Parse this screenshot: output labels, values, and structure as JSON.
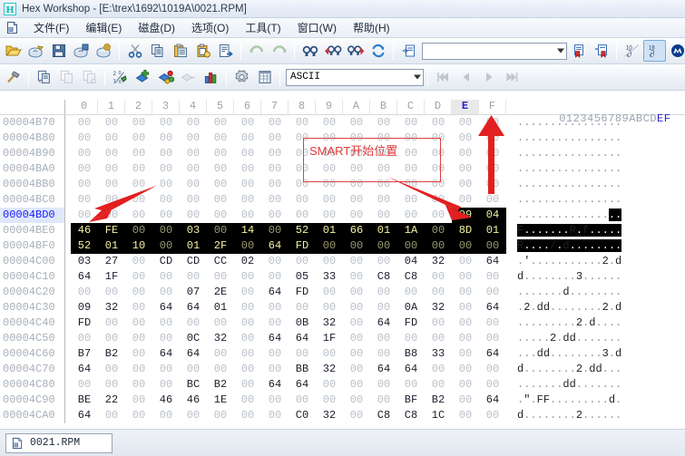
{
  "window": {
    "app_name": "Hex Workshop",
    "title": "Hex Workshop - [E:\\trex\\1692\\1019A\\0021.RPM]",
    "logo_glyph": "H"
  },
  "menu": {
    "doc_icon": "document-icon",
    "items": [
      {
        "label": "文件(F)",
        "name": "menu-file"
      },
      {
        "label": "编辑(E)",
        "name": "menu-edit"
      },
      {
        "label": "磁盘(D)",
        "name": "menu-disk"
      },
      {
        "label": "选项(O)",
        "name": "menu-options"
      },
      {
        "label": "工具(T)",
        "name": "menu-tools"
      },
      {
        "label": "窗口(W)",
        "name": "menu-window"
      },
      {
        "label": "帮助(H)",
        "name": "menu-help"
      }
    ]
  },
  "toolbar1": {
    "buttons": [
      {
        "name": "open-file-icon",
        "title": "Open"
      },
      {
        "name": "open-drive-icon",
        "title": "Open Drive"
      },
      {
        "name": "save-icon",
        "title": "Save"
      },
      {
        "name": "save-all-icon",
        "title": "Save All"
      },
      {
        "name": "save-settings-icon",
        "title": "Save Settings"
      },
      {
        "name": "cut-icon",
        "title": "Cut"
      },
      {
        "name": "copy-icon",
        "title": "Copy"
      },
      {
        "name": "paste-icon",
        "title": "Paste"
      },
      {
        "name": "paste-special-icon",
        "title": "Paste Special"
      },
      {
        "name": "export-icon",
        "title": "Export"
      },
      {
        "name": "undo-icon",
        "title": "Undo"
      },
      {
        "name": "redo-icon",
        "title": "Redo"
      },
      {
        "name": "find-icon",
        "title": "Find"
      },
      {
        "name": "find-prev-icon",
        "title": "Find Previous"
      },
      {
        "name": "find-next-icon",
        "title": "Find Next"
      },
      {
        "name": "refresh-icon",
        "title": "Refresh"
      },
      {
        "name": "goto-icon",
        "title": "Goto"
      }
    ],
    "address_combo_value": "",
    "after_combo": [
      {
        "name": "bookmark-add-icon",
        "title": "Add Bookmark"
      },
      {
        "name": "bookmark-clear-icon",
        "title": "Clear Bookmark"
      },
      {
        "name": "base10-icon",
        "title": "Base 10"
      },
      {
        "name": "base16-icon",
        "title": "Base 16"
      },
      {
        "name": "motorola-icon",
        "title": "Motorola Byte Order"
      },
      {
        "name": "intel-icon",
        "title": "Intel Byte Order"
      }
    ]
  },
  "toolbar2": {
    "buttons": [
      {
        "name": "hammer-icon",
        "title": "Operations"
      },
      {
        "name": "compare-icon",
        "title": "Compare"
      },
      {
        "name": "checksum-icon",
        "title": "Checksum"
      },
      {
        "name": "checksum2-icon",
        "title": "Checksum 2"
      },
      {
        "name": "base-convert-icon",
        "title": "Base Converter"
      },
      {
        "name": "add-structure-icon",
        "title": "Add Structure"
      },
      {
        "name": "add-colormap-icon",
        "title": "Add Color Map"
      },
      {
        "name": "goto-struct-icon",
        "title": "Goto Structure"
      },
      {
        "name": "statistics-icon",
        "title": "Statistics"
      },
      {
        "name": "settings-icon",
        "title": "Preferences"
      },
      {
        "name": "data-inspector-icon",
        "title": "Data Inspector"
      }
    ],
    "charset_combo_value": "ASCII",
    "nav": [
      {
        "name": "nav-first-icon",
        "glyph": "⏮"
      },
      {
        "name": "nav-prev-icon",
        "glyph": "◀"
      },
      {
        "name": "nav-next-icon",
        "glyph": "▶"
      },
      {
        "name": "nav-last-icon",
        "glyph": "⏭"
      }
    ]
  },
  "hex_view": {
    "column_headers": [
      "0",
      "1",
      "2",
      "3",
      "4",
      "5",
      "6",
      "7",
      "8",
      "9",
      "A",
      "B",
      "C",
      "D",
      "E",
      "F"
    ],
    "highlighted_column": "E",
    "ascii_header": "0123456789ABCD",
    "ascii_header_hl": "EF",
    "current_offset_row": "00004BD0",
    "selection": {
      "start": "00004BDE",
      "end": "00004BFF"
    },
    "rows": [
      {
        "offset": "00004B70",
        "bytes": [
          "00",
          "00",
          "00",
          "00",
          "00",
          "00",
          "00",
          "00",
          "00",
          "00",
          "00",
          "00",
          "00",
          "00",
          "00",
          "00"
        ],
        "ascii": "................"
      },
      {
        "offset": "00004B80",
        "bytes": [
          "00",
          "00",
          "00",
          "00",
          "00",
          "00",
          "00",
          "00",
          "00",
          "00",
          "00",
          "00",
          "00",
          "00",
          "00",
          "00"
        ],
        "ascii": "................"
      },
      {
        "offset": "00004B90",
        "bytes": [
          "00",
          "00",
          "00",
          "00",
          "00",
          "00",
          "00",
          "00",
          "00",
          "00",
          "00",
          "00",
          "00",
          "00",
          "00",
          "00"
        ],
        "ascii": "................"
      },
      {
        "offset": "00004BA0",
        "bytes": [
          "00",
          "00",
          "00",
          "00",
          "00",
          "00",
          "00",
          "00",
          "00",
          "00",
          "00",
          "00",
          "00",
          "00",
          "00",
          "00"
        ],
        "ascii": "................"
      },
      {
        "offset": "00004BB0",
        "bytes": [
          "00",
          "00",
          "00",
          "00",
          "00",
          "00",
          "00",
          "00",
          "00",
          "00",
          "00",
          "00",
          "00",
          "00",
          "00",
          "00"
        ],
        "ascii": "................"
      },
      {
        "offset": "00004BC0",
        "bytes": [
          "00",
          "00",
          "00",
          "00",
          "00",
          "00",
          "00",
          "00",
          "00",
          "00",
          "00",
          "00",
          "00",
          "00",
          "00",
          "00"
        ],
        "ascii": "................"
      },
      {
        "offset": "00004BD0",
        "bytes": [
          "00",
          "00",
          "00",
          "00",
          "00",
          "00",
          "00",
          "00",
          "00",
          "00",
          "00",
          "00",
          "00",
          "00",
          "09",
          "04"
        ],
        "ascii": "................"
      },
      {
        "offset": "00004BE0",
        "bytes": [
          "46",
          "FE",
          "00",
          "00",
          "03",
          "00",
          "14",
          "00",
          "52",
          "01",
          "66",
          "01",
          "1A",
          "00",
          "8D",
          "01"
        ],
        "ascii": "F.......R.f....."
      },
      {
        "offset": "00004BF0",
        "bytes": [
          "52",
          "01",
          "10",
          "00",
          "01",
          "2F",
          "00",
          "64",
          "FD",
          "00",
          "00",
          "00",
          "00",
          "00",
          "00",
          "00"
        ],
        "ascii": "R..../.d........"
      },
      {
        "offset": "00004C00",
        "bytes": [
          "03",
          "27",
          "00",
          "CD",
          "CD",
          "CC",
          "02",
          "00",
          "00",
          "00",
          "00",
          "00",
          "04",
          "32",
          "00",
          "64"
        ],
        "ascii": ".'...........2.d"
      },
      {
        "offset": "00004C10",
        "bytes": [
          "64",
          "1F",
          "00",
          "00",
          "00",
          "00",
          "00",
          "00",
          "05",
          "33",
          "00",
          "C8",
          "C8",
          "00",
          "00",
          "00"
        ],
        "ascii": "d........3......"
      },
      {
        "offset": "00004C20",
        "bytes": [
          "00",
          "00",
          "00",
          "00",
          "07",
          "2E",
          "00",
          "64",
          "FD",
          "00",
          "00",
          "00",
          "00",
          "00",
          "00",
          "00"
        ],
        "ascii": ".......d........"
      },
      {
        "offset": "00004C30",
        "bytes": [
          "09",
          "32",
          "00",
          "64",
          "64",
          "01",
          "00",
          "00",
          "00",
          "00",
          "00",
          "00",
          "0A",
          "32",
          "00",
          "64"
        ],
        "ascii": ".2.dd........2.d"
      },
      {
        "offset": "00004C40",
        "bytes": [
          "FD",
          "00",
          "00",
          "00",
          "00",
          "00",
          "00",
          "00",
          "0B",
          "32",
          "00",
          "64",
          "FD",
          "00",
          "00",
          "00"
        ],
        "ascii": ".........2.d...."
      },
      {
        "offset": "00004C50",
        "bytes": [
          "00",
          "00",
          "00",
          "00",
          "0C",
          "32",
          "00",
          "64",
          "64",
          "1F",
          "00",
          "00",
          "00",
          "00",
          "00",
          "00"
        ],
        "ascii": ".....2.dd......."
      },
      {
        "offset": "00004C60",
        "bytes": [
          "B7",
          "B2",
          "00",
          "64",
          "64",
          "00",
          "00",
          "00",
          "00",
          "00",
          "00",
          "00",
          "B8",
          "33",
          "00",
          "64"
        ],
        "ascii": "...dd........3.d"
      },
      {
        "offset": "00004C70",
        "bytes": [
          "64",
          "00",
          "00",
          "00",
          "00",
          "00",
          "00",
          "00",
          "BB",
          "32",
          "00",
          "64",
          "64",
          "00",
          "00",
          "00"
        ],
        "ascii": "d........2.dd..."
      },
      {
        "offset": "00004C80",
        "bytes": [
          "00",
          "00",
          "00",
          "00",
          "BC",
          "B2",
          "00",
          "64",
          "64",
          "00",
          "00",
          "00",
          "00",
          "00",
          "00",
          "00"
        ],
        "ascii": ".......dd......."
      },
      {
        "offset": "00004C90",
        "bytes": [
          "BE",
          "22",
          "00",
          "46",
          "46",
          "1E",
          "00",
          "00",
          "00",
          "00",
          "00",
          "00",
          "BF",
          "B2",
          "00",
          "64"
        ],
        "ascii": ".\".FF.........d"
      },
      {
        "offset": "00004CA0",
        "bytes": [
          "64",
          "00",
          "00",
          "00",
          "00",
          "00",
          "00",
          "00",
          "C0",
          "32",
          "00",
          "C8",
          "C8",
          "1C",
          "00",
          "00"
        ],
        "ascii": "d........2......"
      }
    ]
  },
  "annotations": {
    "label": "SMART开始位置",
    "color": "#e23a3a"
  },
  "status": {
    "tab_label": "0021.RPM",
    "tab_icon": "document-icon"
  }
}
